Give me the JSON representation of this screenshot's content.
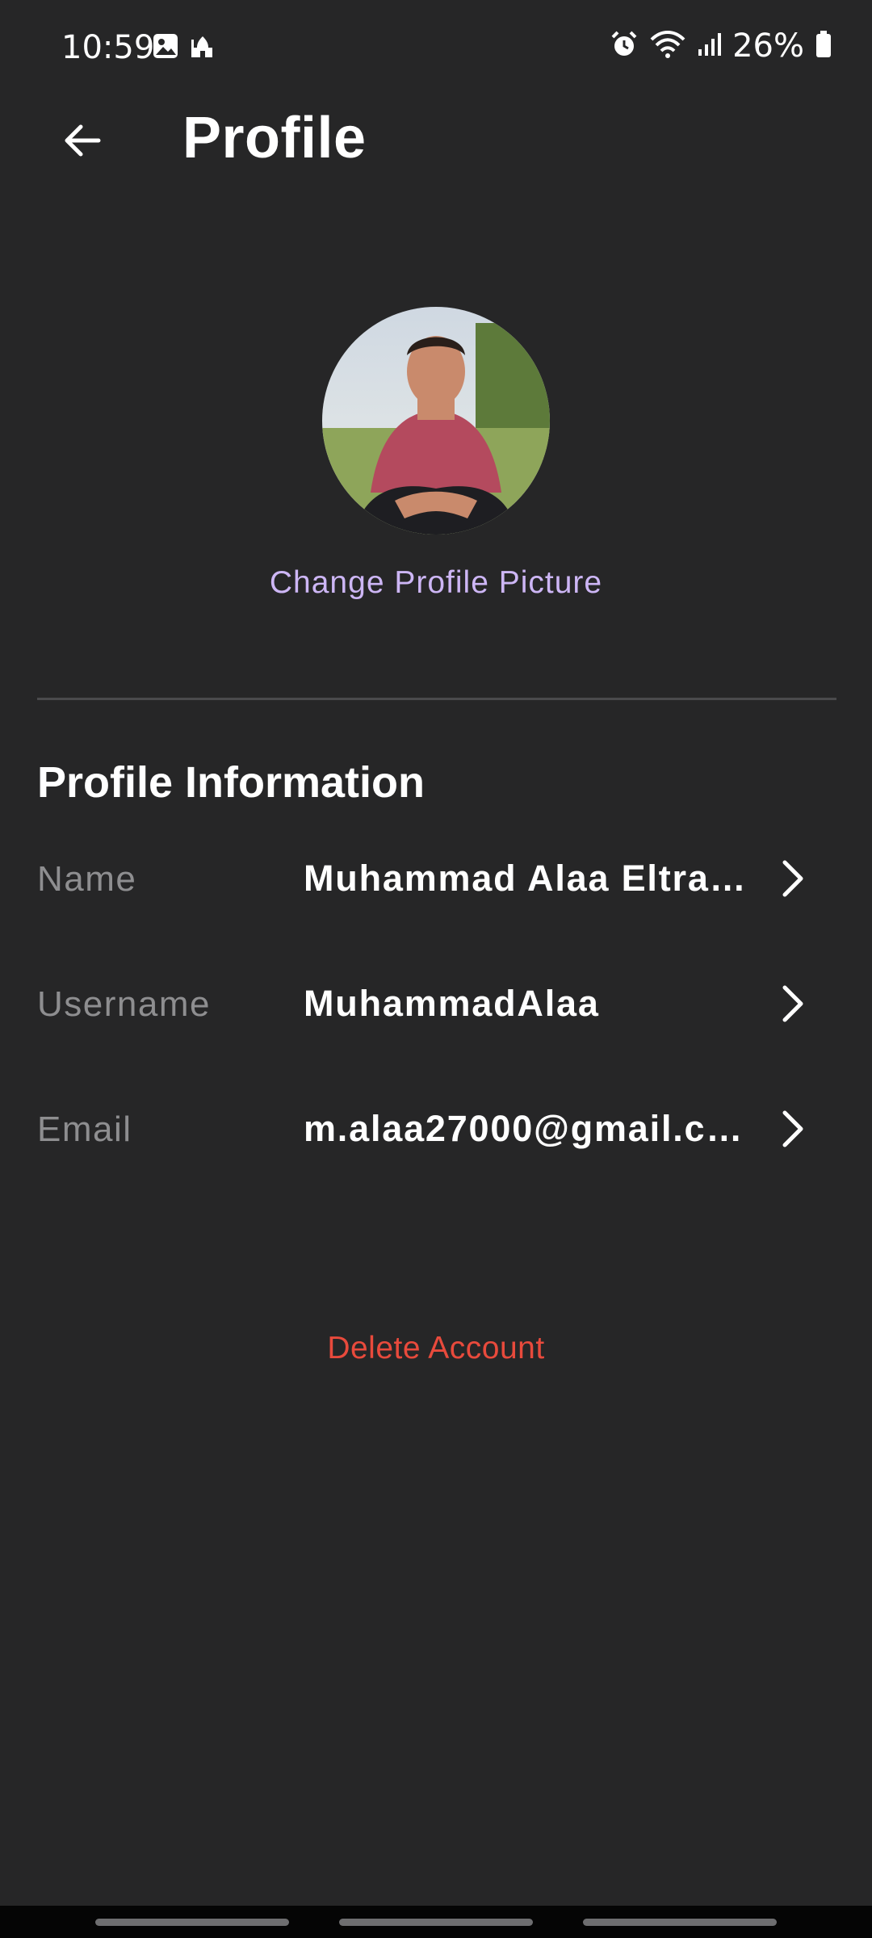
{
  "status_bar": {
    "time": "10:59",
    "battery": "26%",
    "icons": [
      "gallery-icon",
      "mosque-icon",
      "alarm-icon",
      "wifi-icon",
      "signal-icon",
      "battery-icon"
    ]
  },
  "header": {
    "title": "Profile",
    "back_icon": "arrow-left-icon"
  },
  "profile": {
    "change_picture_label": "Change Profile Picture"
  },
  "section": {
    "title": "Profile Information"
  },
  "fields": [
    {
      "label": "Name",
      "value": "Muhammad Alaa Eltra…"
    },
    {
      "label": "Username",
      "value": "MuhammadAlaa"
    },
    {
      "label": "Email",
      "value": "m.alaa27000@gmail.c…"
    }
  ],
  "actions": {
    "delete_label": "Delete Account"
  },
  "colors": {
    "background": "#262627",
    "accent": "#cdb6f5",
    "danger": "#e84a3c",
    "label": "#8e8e90"
  }
}
